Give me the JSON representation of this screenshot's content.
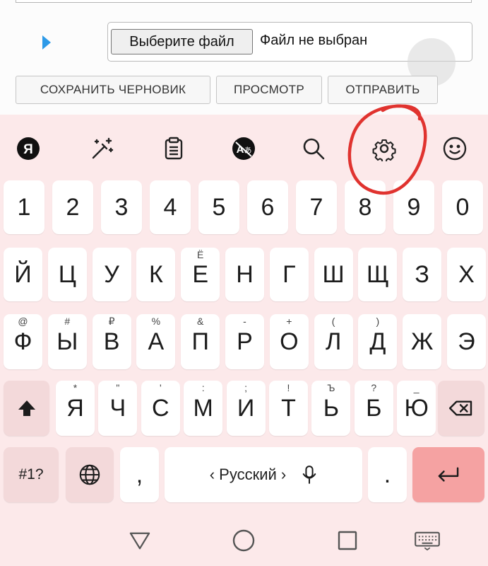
{
  "form": {
    "file_button_label": "Выберите файл",
    "file_status": "Файл не выбран",
    "actions": [
      "СОХРАНИТЬ ЧЕРНОВИК",
      "ПРОСМОТР",
      "ОТПРАВИТЬ"
    ]
  },
  "keyboard": {
    "toolbar": [
      "yandex-logo-icon",
      "magic-wand-icon",
      "clipboard-icon",
      "translate-icon",
      "search-icon",
      "gear-icon",
      "emoji-icon"
    ],
    "yandex_logo_letter": "Я",
    "number_row": [
      "1",
      "2",
      "3",
      "4",
      "5",
      "6",
      "7",
      "8",
      "9",
      "0"
    ],
    "row1": [
      {
        "label": "Й",
        "hint": ""
      },
      {
        "label": "Ц",
        "hint": ""
      },
      {
        "label": "У",
        "hint": ""
      },
      {
        "label": "К",
        "hint": ""
      },
      {
        "label": "Е",
        "hint": "Ё"
      },
      {
        "label": "Н",
        "hint": ""
      },
      {
        "label": "Г",
        "hint": ""
      },
      {
        "label": "Ш",
        "hint": ""
      },
      {
        "label": "Щ",
        "hint": ""
      },
      {
        "label": "З",
        "hint": ""
      },
      {
        "label": "Х",
        "hint": ""
      }
    ],
    "row2": [
      {
        "label": "Ф",
        "hint": "@"
      },
      {
        "label": "Ы",
        "hint": "#"
      },
      {
        "label": "В",
        "hint": "₽"
      },
      {
        "label": "А",
        "hint": "%"
      },
      {
        "label": "П",
        "hint": "&"
      },
      {
        "label": "Р",
        "hint": "-"
      },
      {
        "label": "О",
        "hint": "+"
      },
      {
        "label": "Л",
        "hint": "("
      },
      {
        "label": "Д",
        "hint": ")"
      },
      {
        "label": "Ж",
        "hint": ""
      },
      {
        "label": "Э",
        "hint": ""
      }
    ],
    "row3": [
      {
        "label": "Я",
        "hint": "*"
      },
      {
        "label": "Ч",
        "hint": "\""
      },
      {
        "label": "С",
        "hint": "'"
      },
      {
        "label": "М",
        "hint": ":"
      },
      {
        "label": "И",
        "hint": ";"
      },
      {
        "label": "Т",
        "hint": "!"
      },
      {
        "label": "Ь",
        "hint": "Ъ"
      },
      {
        "label": "Б",
        "hint": "?"
      },
      {
        "label": "Ю",
        "hint": "_"
      }
    ],
    "symbols_key": "#1?",
    "comma": ",",
    "period": ".",
    "space_label": "‹ Русский ›",
    "shift_icon": "shift-arrow-icon",
    "backspace_icon": "backspace-icon",
    "globe_icon": "globe-icon",
    "mic_icon": "microphone-icon",
    "enter_icon": "enter-arrow-icon",
    "enter_color": "#f5a2a2",
    "keyboard_bg": "#fce9ea"
  },
  "navbar": {
    "buttons": [
      "back-triangle-icon",
      "home-circle-icon",
      "recents-square-icon",
      "keyboard-switch-icon"
    ]
  },
  "annotation": {
    "color": "#e0332f",
    "target": "gear-icon"
  }
}
